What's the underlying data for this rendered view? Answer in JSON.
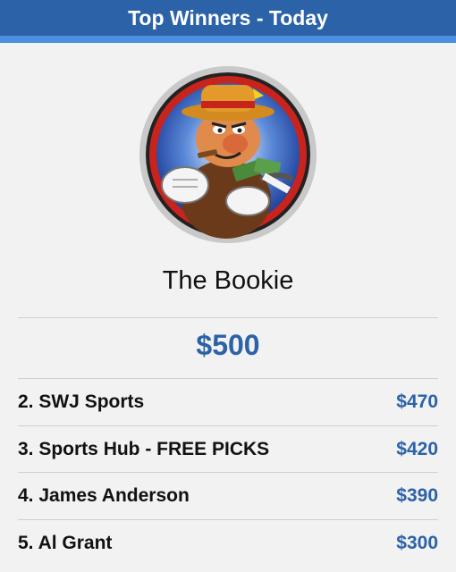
{
  "header": {
    "title": "Top Winners - Today"
  },
  "winner": {
    "name": "The Bookie",
    "amount": "$500",
    "avatar_icon": "bookie-mascot-avatar"
  },
  "leaderboard": [
    {
      "label": "2. SWJ Sports",
      "amount": "$470"
    },
    {
      "label": "3. Sports Hub - FREE PICKS",
      "amount": "$420"
    },
    {
      "label": "4. James Anderson",
      "amount": "$390"
    },
    {
      "label": "5. Al Grant",
      "amount": "$300"
    }
  ],
  "colors": {
    "header_bg": "#2b62a8",
    "accent_text": "#2b62a8",
    "background": "#f2f2f2"
  }
}
